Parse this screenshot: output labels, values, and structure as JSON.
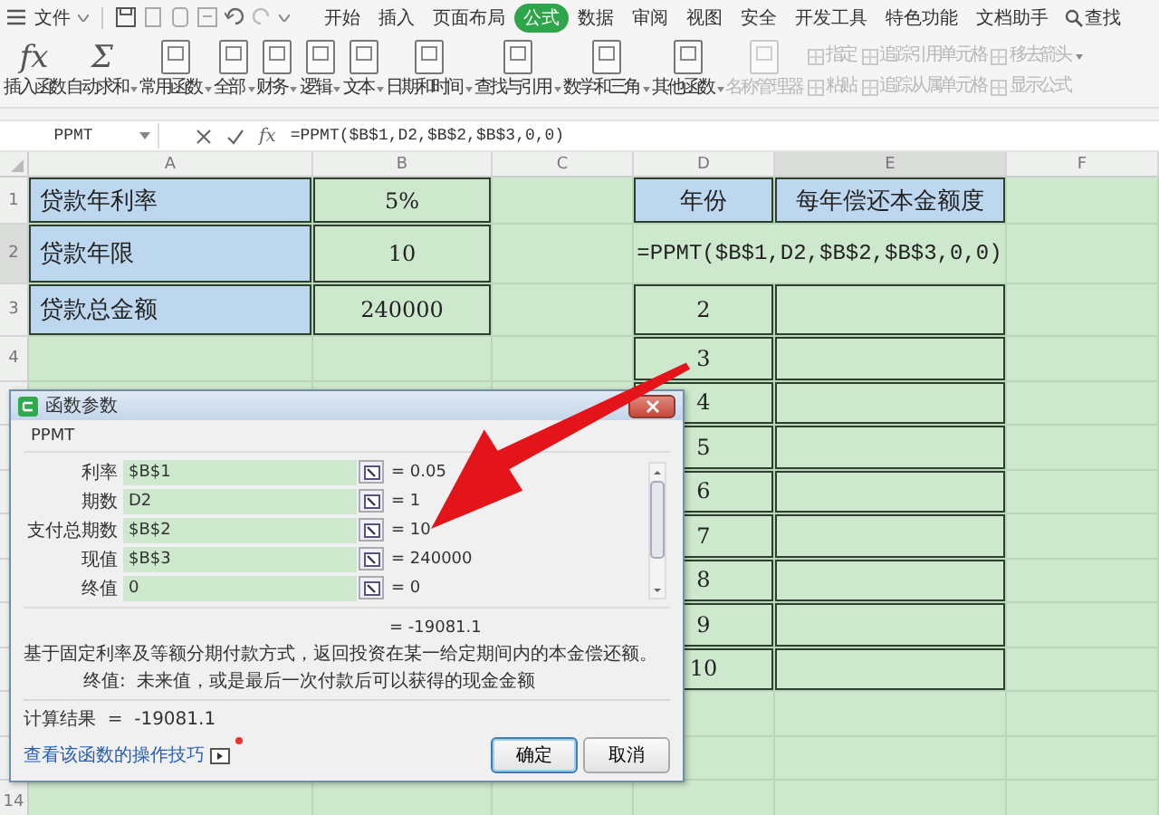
{
  "menu_bar": {
    "app_menu": "文件",
    "tabs": [
      {
        "label": "开始",
        "selected": false
      },
      {
        "label": "插入",
        "selected": false
      },
      {
        "label": "页面布局",
        "selected": false
      },
      {
        "label": "公式",
        "selected": true
      },
      {
        "label": "数据",
        "selected": false
      },
      {
        "label": "审阅",
        "selected": false
      },
      {
        "label": "视图",
        "selected": false
      },
      {
        "label": "安全",
        "selected": false
      },
      {
        "label": "开发工具",
        "selected": false
      },
      {
        "label": "特色功能",
        "selected": false
      },
      {
        "label": "文档助手",
        "selected": false
      }
    ],
    "search": "查找"
  },
  "ribbon": {
    "buttons": [
      {
        "kind": "glyph",
        "glyph": "fx",
        "label": "插入函数",
        "dropdown": false,
        "disabled": false
      },
      {
        "kind": "glyph",
        "glyph": "Σ",
        "label": "自动求和",
        "dropdown": true,
        "disabled": false
      },
      {
        "kind": "card",
        "label": "常用函数",
        "dropdown": true,
        "disabled": false
      },
      {
        "kind": "card",
        "label": "全部",
        "dropdown": true,
        "disabled": false
      },
      {
        "kind": "card",
        "label": "财务",
        "dropdown": true,
        "disabled": false
      },
      {
        "kind": "card",
        "label": "逻辑",
        "dropdown": true,
        "disabled": false
      },
      {
        "kind": "card",
        "label": "文本",
        "dropdown": true,
        "disabled": false
      },
      {
        "kind": "card",
        "label": "日期和时间",
        "dropdown": true,
        "disabled": false
      },
      {
        "kind": "card",
        "label": "查找与引用",
        "dropdown": true,
        "disabled": false
      },
      {
        "kind": "card",
        "label": "数学和三角",
        "dropdown": true,
        "disabled": false
      },
      {
        "kind": "card",
        "label": "其他函数",
        "dropdown": true,
        "disabled": false
      },
      {
        "kind": "card",
        "label": "名称管理器",
        "dropdown": false,
        "disabled": true
      }
    ],
    "tool_stacks": [
      {
        "items": [
          {
            "label": "指定",
            "dropdown": false,
            "disabled": true
          },
          {
            "label": "粘贴",
            "dropdown": false,
            "disabled": true
          }
        ]
      },
      {
        "items": [
          {
            "label": "追踪引用单元格",
            "dropdown": false,
            "disabled": true
          },
          {
            "label": "追踪从属单元格",
            "dropdown": false,
            "disabled": true
          }
        ]
      },
      {
        "items": [
          {
            "label": "移去箭头",
            "dropdown": true,
            "disabled": true
          },
          {
            "label": "显示公式",
            "dropdown": false,
            "disabled": true
          }
        ]
      }
    ]
  },
  "formula_bar": {
    "name_box": "PPMT",
    "fx": "fx",
    "formula": "=PPMT($B$1,D2,$B$2,$B$3,0,0)"
  },
  "sheet": {
    "columns": [
      {
        "label": "A",
        "selected": false
      },
      {
        "label": "B",
        "selected": false
      },
      {
        "label": "C",
        "selected": false
      },
      {
        "label": "D",
        "selected": false
      },
      {
        "label": "E",
        "selected": true
      },
      {
        "label": "F",
        "selected": false
      }
    ],
    "rows": [
      {
        "number": "1",
        "selected": false,
        "kind": "header",
        "a": "贷款年利率",
        "b": "5%",
        "d": "年份",
        "e": "每年偿还本金额度"
      },
      {
        "number": "2",
        "selected": true,
        "kind": "formula",
        "a": "贷款年限",
        "b": "10",
        "formula": "=PPMT($B$1,D2,$B$2,$B$3,0,0)"
      },
      {
        "number": "3",
        "selected": false,
        "kind": "data",
        "a": "贷款总金额",
        "b": "240000",
        "d": "2"
      },
      {
        "number": "4",
        "selected": false,
        "kind": "data",
        "d": "3"
      },
      {
        "selected": false,
        "kind": "data",
        "d": "4"
      },
      {
        "selected": false,
        "kind": "data",
        "d": "5"
      },
      {
        "selected": false,
        "kind": "data",
        "d": "6"
      },
      {
        "selected": false,
        "kind": "data",
        "d": "7"
      },
      {
        "selected": false,
        "kind": "data",
        "d": "8"
      },
      {
        "selected": false,
        "kind": "data",
        "d": "9"
      },
      {
        "selected": false,
        "kind": "data",
        "d": "10"
      },
      {
        "selected": false,
        "kind": "blank"
      },
      {
        "selected": false,
        "kind": "blank"
      },
      {
        "number": "14",
        "selected": false,
        "kind": "blank"
      }
    ]
  },
  "dialog": {
    "title": "函数参数",
    "function": "PPMT",
    "arguments": [
      {
        "label": "利率",
        "value": "$B$1",
        "result": "= 0.05"
      },
      {
        "label": "期数",
        "value": "D2",
        "result": "= 1"
      },
      {
        "label": "支付总期数",
        "value": "$B$2",
        "result": "= 10"
      },
      {
        "label": "现值",
        "value": "$B$3",
        "result": "= 240000"
      },
      {
        "label": "终值",
        "value": "0",
        "result": "= 0"
      }
    ],
    "result": "= -19081.1",
    "description": "基于固定利率及等额分期付款方式，返回投资在某一给定期间内的本金偿还额。",
    "argument_help": {
      "label": "终值:",
      "text": "未来值，或是最后一次付款后可以获得的现金金额"
    },
    "calc_result": "计算结果  =  -19081.1",
    "link": "查看该函数的操作技巧",
    "buttons": [
      {
        "label": "确定",
        "default": true
      },
      {
        "label": "取消",
        "default": false
      }
    ]
  }
}
